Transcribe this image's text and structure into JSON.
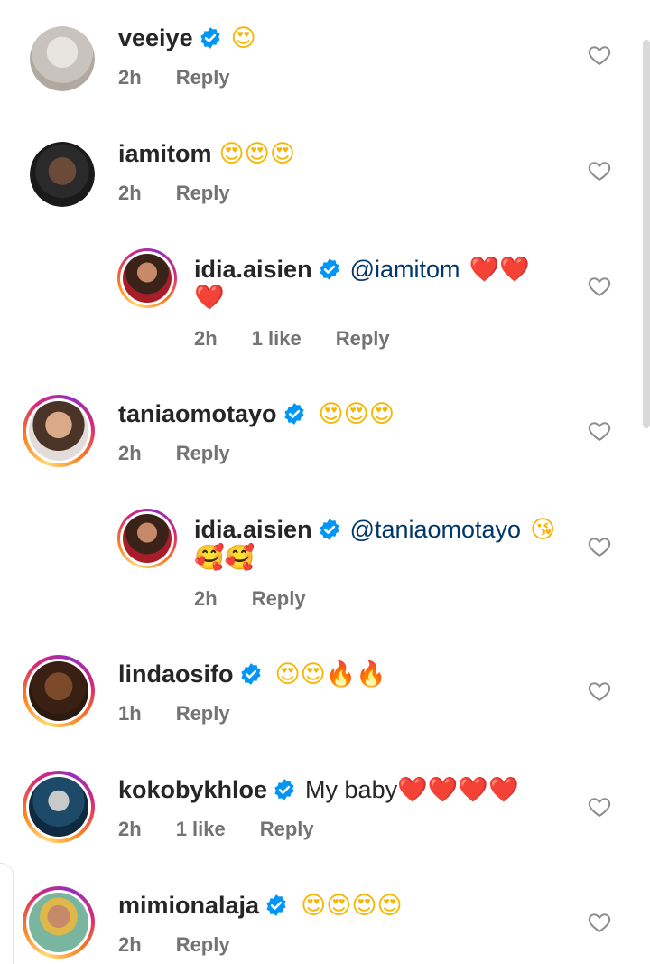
{
  "comments": [
    {
      "username": "veeiye",
      "verified": true,
      "text": "",
      "emoji": "😍",
      "time": "2h",
      "likes": "",
      "reply": "Reply",
      "avatar_color": "#c9c3bd"
    },
    {
      "username": "iamitom",
      "verified": false,
      "text": "",
      "emoji": "😍😍😍",
      "time": "2h",
      "likes": "",
      "reply": "Reply",
      "avatar_color": "#3a3a3a"
    },
    {
      "username": "idia.aisien",
      "verified": true,
      "mention": "@iamitom",
      "emoji": "❤️❤️",
      "emoji2": "❤️",
      "time": "2h",
      "likes": "1 like",
      "reply": "Reply",
      "avatar_color": "#8a4a3a"
    },
    {
      "username": "taniaomotayo",
      "verified": true,
      "text": "",
      "emoji": "😍😍😍",
      "time": "2h",
      "likes": "",
      "reply": "Reply",
      "avatar_color": "#cfa78d"
    },
    {
      "username": "idia.aisien",
      "verified": true,
      "mention": "@taniaomotayo",
      "emoji": "😘",
      "emoji2": "🥰🥰",
      "time": "2h",
      "likes": "",
      "reply": "Reply",
      "avatar_color": "#8a4a3a"
    },
    {
      "username": "lindaosifo",
      "verified": true,
      "text": "",
      "emoji": "😍😍🔥🔥",
      "time": "1h",
      "likes": "",
      "reply": "Reply",
      "avatar_color": "#5a3320"
    },
    {
      "username": "kokobykhloe",
      "verified": true,
      "text": "My baby",
      "emoji": "❤️❤️❤️❤️",
      "time": "2h",
      "likes": "1 like",
      "reply": "Reply",
      "avatar_color": "#2d5a7a"
    },
    {
      "username": "mimionalaja",
      "verified": true,
      "text": "",
      "emoji": "😍😍😍😍",
      "time": "2h",
      "likes": "",
      "reply": "Reply",
      "avatar_color": "#7ab5a0"
    }
  ],
  "icons": {
    "verified": "verified-badge-icon",
    "like": "heart-outline-icon"
  },
  "colors": {
    "verified": "#0095f6",
    "mention": "#00376b",
    "meta": "#737373"
  }
}
